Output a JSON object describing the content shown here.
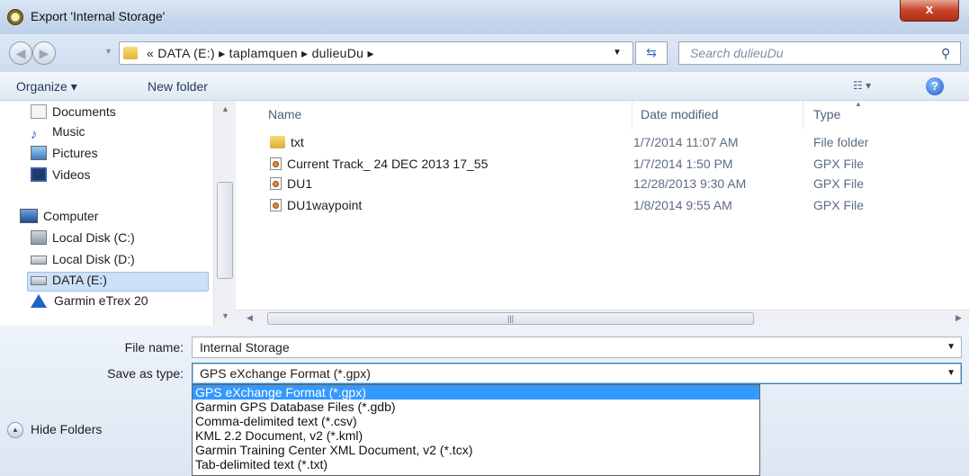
{
  "window": {
    "title": "Export 'Internal Storage'",
    "close_label": "x"
  },
  "address": {
    "prefix": "«",
    "path": [
      "DATA (E:)",
      "taplamquen",
      "dulieuDu"
    ],
    "separator": "▸",
    "search_placeholder": "Search dulieuDu"
  },
  "toolbar": {
    "organize": "Organize ▾",
    "new_folder": "New folder"
  },
  "nav_pane": {
    "items": [
      {
        "label": "Documents",
        "icon": "documents-icon"
      },
      {
        "label": "Music",
        "icon": "music-icon"
      },
      {
        "label": "Pictures",
        "icon": "pictures-icon"
      },
      {
        "label": "Videos",
        "icon": "videos-icon"
      },
      {
        "label": "Computer",
        "icon": "computer-icon"
      },
      {
        "label": "Local Disk (C:)",
        "icon": "drive-icon"
      },
      {
        "label": "Local Disk (D:)",
        "icon": "drive-icon"
      },
      {
        "label": "DATA (E:)",
        "icon": "drive-icon",
        "selected": true
      },
      {
        "label": "Garmin eTrex 20",
        "icon": "garmin-icon"
      }
    ]
  },
  "file_list": {
    "columns": {
      "name": "Name",
      "date": "Date modified",
      "type": "Type"
    },
    "rows": [
      {
        "name": "txt",
        "date": "1/7/2014 11:07 AM",
        "type": "File folder",
        "icon": "folder-icon"
      },
      {
        "name": "Current Track_ 24 DEC 2013 17_55",
        "date": "1/7/2014 1:50 PM",
        "type": "GPX File",
        "icon": "gpx-file-icon"
      },
      {
        "name": "DU1",
        "date": "12/28/2013 9:30 AM",
        "type": "GPX File",
        "icon": "gpx-file-icon"
      },
      {
        "name": "DU1waypoint",
        "date": "1/8/2014 9:55 AM",
        "type": "GPX File",
        "icon": "gpx-file-icon"
      }
    ]
  },
  "form": {
    "file_name_label": "File name:",
    "file_name_value": "Internal Storage",
    "save_type_label": "Save as type:",
    "save_type_value": "GPS eXchange Format (*.gpx)",
    "save_type_options": [
      "GPS eXchange Format (*.gpx)",
      "Garmin GPS Database Files (*.gdb)",
      "Comma-delimited text (*.csv)",
      "KML 2.2 Document, v2 (*.kml)",
      "Garmin Training Center XML Document, v2 (*.tcx)",
      "Tab-delimited text (*.txt)"
    ],
    "hide_folders": "Hide Folders"
  },
  "colors": {
    "selection": "#3399ff",
    "titlebar": "#c5d6ec",
    "close": "#c7432a"
  }
}
